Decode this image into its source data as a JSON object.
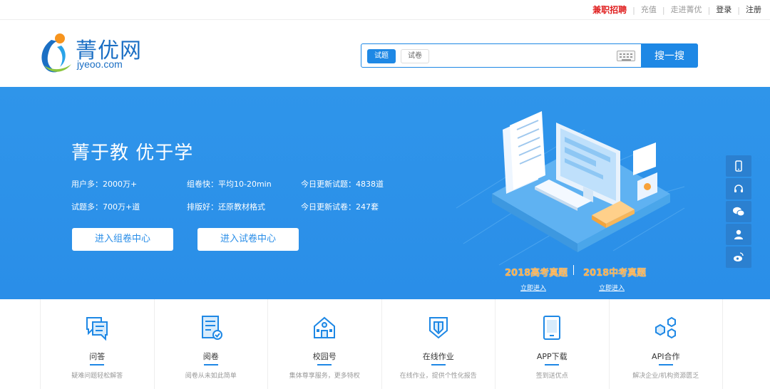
{
  "topbar": {
    "links": [
      "兼职招聘",
      "充值",
      "走进菁优",
      "登录",
      "注册"
    ]
  },
  "logo": {
    "cn": "菁优网",
    "en": "jyeoo.com"
  },
  "search": {
    "tabs": [
      "试题",
      "试卷"
    ],
    "placeholder": "",
    "button": "搜一搜"
  },
  "banner": {
    "slogan": "菁于教 优于学",
    "stats": [
      "用户多：2000万+",
      "组卷快：平均10-20min",
      "今日更新试题：4838道",
      "试题多：700万+道",
      "排版好：还原教材格式",
      "今日更新试卷：247套"
    ],
    "buttons": [
      "进入组卷中心",
      "进入试卷中心"
    ],
    "promo": [
      {
        "title": "2018高考真题",
        "link": "立即进入"
      },
      {
        "title": "2018中考真题",
        "link": "立即进入"
      }
    ]
  },
  "sidebar": {
    "icons": [
      "phone-icon",
      "headset-icon",
      "wechat-icon",
      "user-icon",
      "weibo-icon"
    ]
  },
  "features": [
    {
      "title": "问答",
      "desc": "疑难问题轻松解答",
      "icon": "chat-icon"
    },
    {
      "title": "阅卷",
      "desc": "阅卷从未如此简单",
      "icon": "document-check-icon"
    },
    {
      "title": "校园号",
      "desc": "集体尊享服务，更多特权",
      "icon": "school-icon"
    },
    {
      "title": "在线作业",
      "desc": "在线作业，提供个性化报告",
      "icon": "pencil-shield-icon"
    },
    {
      "title": "APP下载",
      "desc": "签到送优点",
      "icon": "tablet-icon"
    },
    {
      "title": "API合作",
      "desc": "解决企业/机构资源匮乏",
      "icon": "hexagons-icon"
    }
  ],
  "colors": {
    "accent": "#1e88e5",
    "banner": "#2a8ee8",
    "promo": "#ffb14a",
    "hot": "#e02020"
  }
}
